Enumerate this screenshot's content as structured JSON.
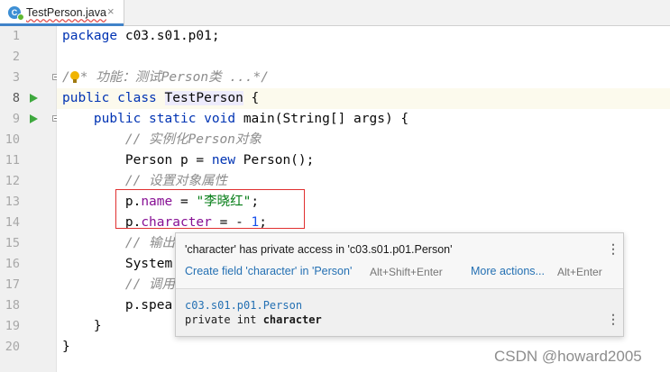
{
  "tab": {
    "label": "TestPerson.java",
    "icon_letter": "C",
    "close": "×"
  },
  "gutter": {
    "line_numbers": [
      "1",
      "2",
      "3",
      "8",
      "9",
      "10",
      "11",
      "12",
      "13",
      "14",
      "15",
      "16",
      "17",
      "18",
      "19",
      "20"
    ]
  },
  "code": {
    "l1": {
      "kw": "package",
      "rest": " c03.s01.p01;"
    },
    "l3": {
      "pre": "/",
      "comment": "* 功能：测试Person类 ...*/"
    },
    "l8": {
      "kw1": "public",
      "kw2": "class",
      "cls": "TestPerson",
      "rest": " {"
    },
    "l9": {
      "kw1": "public",
      "kw2": "static",
      "kw3": "void",
      "rest": " main(String[] args) {"
    },
    "l10": {
      "comment": "// 实例化Person对象"
    },
    "l11": {
      "pre": "Person p = ",
      "kw": "new",
      "rest": " Person();"
    },
    "l12": {
      "comment": "// 设置对象属性"
    },
    "l13": {
      "obj": "p.",
      "field": "name",
      "eq": " = ",
      "str": "\"李晓红\"",
      "end": ";"
    },
    "l14": {
      "obj": "p.",
      "field": "character",
      "eq": " = - ",
      "num": "1",
      "end": ";"
    },
    "l15": {
      "comment": "// 输出"
    },
    "l16": {
      "text": "System"
    },
    "l17": {
      "comment": "// 调用"
    },
    "l18": {
      "text": "p.spea"
    },
    "l19": {
      "text": "}"
    },
    "l20": {
      "text": "}"
    }
  },
  "popup": {
    "message": "'character' has private access in 'c03.s01.p01.Person'",
    "fix_action": "Create field 'character' in 'Person'",
    "fix_shortcut": "Alt+Shift+Enter",
    "more_actions": "More actions...",
    "more_shortcut": "Alt+Enter",
    "doc_fqn": "c03.s01.p01.Person",
    "doc_decl_prefix": "private int ",
    "doc_decl_name": "character",
    "kebab": "⋮"
  },
  "watermark": "CSDN @howard2005",
  "colors": {
    "keyword": "#0033b3",
    "comment": "#8c8c8c",
    "field": "#871094",
    "string": "#067d17",
    "number": "#1750eb",
    "highlight_box": "#e03030",
    "link": "#2470b3",
    "run_icon": "#3ea83e"
  }
}
